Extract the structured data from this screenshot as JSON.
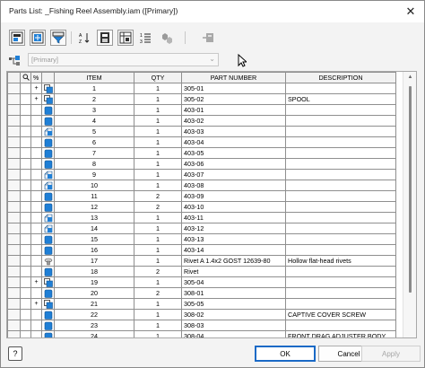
{
  "window": {
    "title": "Parts List: _Fishing Reel Assembly.iam ([Primary])",
    "close_glyph": "✕"
  },
  "toolbar": {
    "icons": [
      "column-chooser-icon",
      "group-settings-icon",
      "filter-settings-icon",
      "sort-icon",
      "export-icon",
      "table-layout-icon",
      "renumber-icon",
      "add-custom-part-icon",
      "member-selection-icon"
    ]
  },
  "filter": {
    "value": "[Primary]",
    "arrow": "⌄"
  },
  "columns": {
    "handle": "",
    "item": "ITEM",
    "qty": "QTY",
    "part_number": "PART NUMBER",
    "description": "DESCRIPTION"
  },
  "rows": [
    {
      "exp": "+",
      "icon": "assembly",
      "item": "1",
      "qty": "1",
      "part": "305-01",
      "desc": ""
    },
    {
      "exp": "+",
      "icon": "assembly",
      "item": "2",
      "qty": "1",
      "part": "305-02",
      "desc": "SPOOL"
    },
    {
      "exp": "",
      "icon": "part",
      "item": "3",
      "qty": "1",
      "part": "403-01",
      "desc": ""
    },
    {
      "exp": "",
      "icon": "part",
      "item": "4",
      "qty": "1",
      "part": "403-02",
      "desc": ""
    },
    {
      "exp": "",
      "icon": "sheet",
      "item": "5",
      "qty": "1",
      "part": "403-03",
      "desc": ""
    },
    {
      "exp": "",
      "icon": "part",
      "item": "6",
      "qty": "1",
      "part": "403-04",
      "desc": ""
    },
    {
      "exp": "",
      "icon": "part",
      "item": "7",
      "qty": "1",
      "part": "403-05",
      "desc": ""
    },
    {
      "exp": "",
      "icon": "part",
      "item": "8",
      "qty": "1",
      "part": "403-06",
      "desc": ""
    },
    {
      "exp": "",
      "icon": "sheet",
      "item": "9",
      "qty": "1",
      "part": "403-07",
      "desc": ""
    },
    {
      "exp": "",
      "icon": "sheet",
      "item": "10",
      "qty": "1",
      "part": "403-08",
      "desc": ""
    },
    {
      "exp": "",
      "icon": "part",
      "item": "11",
      "qty": "2",
      "part": "403-09",
      "desc": ""
    },
    {
      "exp": "",
      "icon": "part",
      "item": "12",
      "qty": "2",
      "part": "403-10",
      "desc": ""
    },
    {
      "exp": "",
      "icon": "sheet",
      "item": "13",
      "qty": "1",
      "part": "403-11",
      "desc": ""
    },
    {
      "exp": "",
      "icon": "sheet",
      "item": "14",
      "qty": "1",
      "part": "403-12",
      "desc": ""
    },
    {
      "exp": "",
      "icon": "part",
      "item": "15",
      "qty": "1",
      "part": "403-13",
      "desc": ""
    },
    {
      "exp": "",
      "icon": "part",
      "item": "16",
      "qty": "1",
      "part": "403-14",
      "desc": ""
    },
    {
      "exp": "",
      "icon": "rivet",
      "item": "17",
      "qty": "1",
      "part": "Rivet A 1.4x2 GOST 12639-80",
      "desc": "Hollow flat-head rivets"
    },
    {
      "exp": "",
      "icon": "part",
      "item": "18",
      "qty": "2",
      "part": "Rivet",
      "desc": ""
    },
    {
      "exp": "+",
      "icon": "assembly",
      "item": "19",
      "qty": "1",
      "part": "305-04",
      "desc": ""
    },
    {
      "exp": "",
      "icon": "part",
      "item": "20",
      "qty": "2",
      "part": "308-01",
      "desc": ""
    },
    {
      "exp": "+",
      "icon": "assembly",
      "item": "21",
      "qty": "1",
      "part": "305-05",
      "desc": ""
    },
    {
      "exp": "",
      "icon": "part",
      "item": "22",
      "qty": "1",
      "part": "308-02",
      "desc": "CAPTIVE COVER SCREW"
    },
    {
      "exp": "",
      "icon": "part",
      "item": "23",
      "qty": "1",
      "part": "308-03",
      "desc": ""
    },
    {
      "exp": "",
      "icon": "part",
      "item": "24",
      "qty": "1",
      "part": "308-04",
      "desc": "FRONT DRAG ADJUSTER BODY"
    }
  ],
  "buttons": {
    "help": "?",
    "ok": "OK",
    "cancel": "Cancel",
    "apply": "Apply"
  },
  "colors": {
    "part_blue": "#1f7fd6",
    "ok_border": "#1a6ac6"
  }
}
